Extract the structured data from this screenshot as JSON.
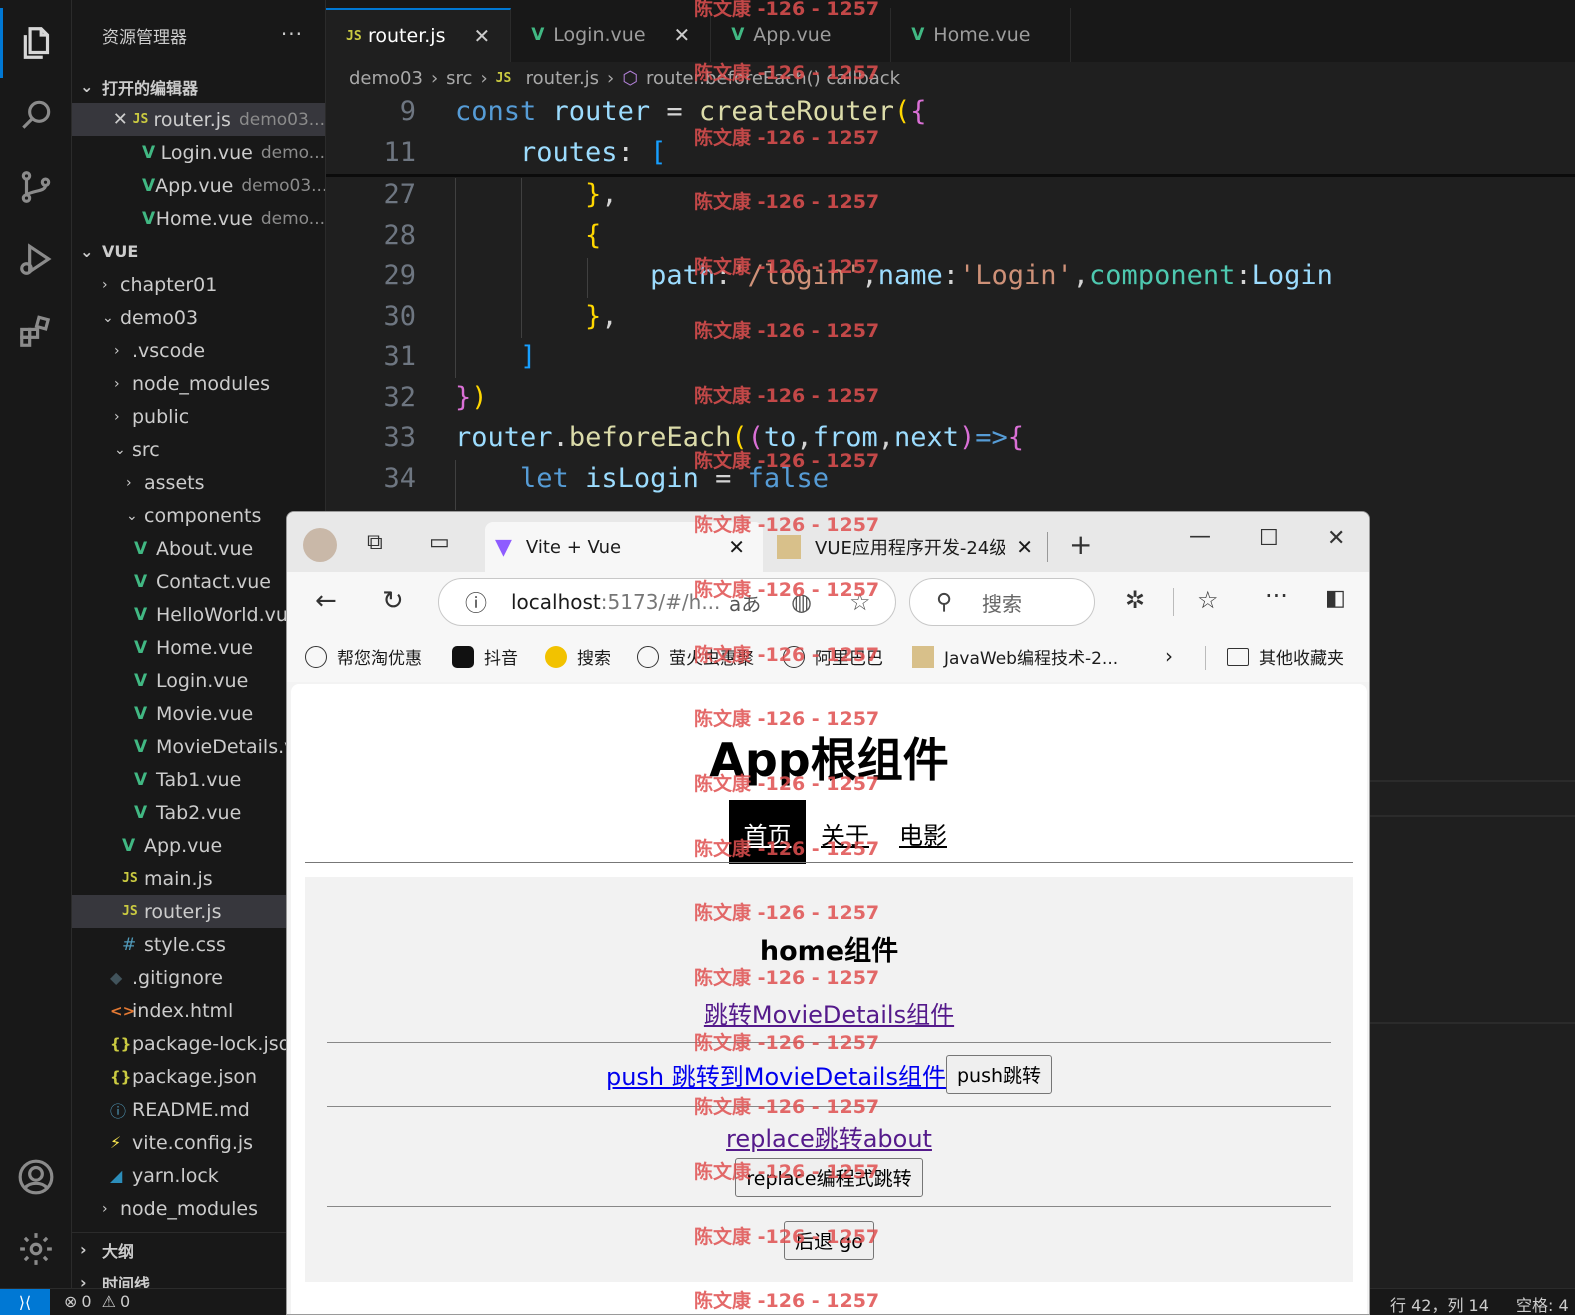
{
  "sidebar": {
    "title": "资源管理器",
    "more": "···",
    "open_editors": {
      "label": "打开的编辑器",
      "items": [
        {
          "name": "router.js",
          "desc": "demo03..."
        },
        {
          "name": "Login.vue",
          "desc": "demo..."
        },
        {
          "name": "App.vue",
          "desc": "demo03..."
        },
        {
          "name": "Home.vue",
          "desc": "demo..."
        }
      ]
    },
    "workspace": "VUE",
    "tree": {
      "chapter01": "chapter01",
      "demo03": "demo03",
      "vscode": ".vscode",
      "node_modules": "node_modules",
      "public": "public",
      "src": "src",
      "assets": "assets",
      "components": "components",
      "components_files": [
        "About.vue",
        "Contact.vue",
        "HelloWorld.vue",
        "Home.vue",
        "Login.vue",
        "Movie.vue",
        "MovieDetails.vue",
        "Tab1.vue",
        "Tab2.vue"
      ],
      "app": "App.vue",
      "main": "main.js",
      "router": "router.js",
      "style": "style.css",
      "gitignore": ".gitignore",
      "index": "index.html",
      "lock": "package-lock.json",
      "pkg": "package.json",
      "readme": "README.md",
      "vite": "vite.config.js",
      "yarn": "yarn.lock",
      "node_modules2": "node_modules"
    },
    "outline": "大纲",
    "timeline": "时间线"
  },
  "editor": {
    "tabs": [
      "router.js",
      "Login.vue",
      "App.vue",
      "Home.vue"
    ],
    "breadcrumb": [
      "demo03",
      "src",
      "router.js",
      "router.beforeEach() callback"
    ],
    "lines": [
      "9",
      "11",
      "27",
      "28",
      "29",
      "30",
      "31",
      "32",
      "33",
      "34"
    ],
    "code": {
      "l9": [
        "const",
        "router",
        "=",
        "createRouter",
        "(",
        "{"
      ],
      "l11": [
        "routes",
        ":",
        "["
      ],
      "l27": [
        "}",
        ","
      ],
      "l28": [
        "{"
      ],
      "l29": [
        "path",
        ":",
        "'/login'",
        ",",
        "name",
        ":",
        "'Login'",
        ",",
        "component",
        ":",
        "Login"
      ],
      "l30": [
        "}",
        ","
      ],
      "l31": [
        "]"
      ],
      "l32": [
        "}",
        ")"
      ],
      "l33": [
        "router",
        ".",
        "beforeEach",
        "(",
        "(",
        "to",
        ",",
        "from",
        ",",
        "next",
        ")",
        "=>",
        "{"
      ],
      "l34": [
        "let",
        "isLogin",
        "=",
        "false"
      ]
    }
  },
  "status": {
    "errors": "0",
    "warnings": "0",
    "position": "行 42，列 14",
    "spaces": "空格: 4"
  },
  "browser": {
    "tabs": [
      {
        "title": "Vite + Vue"
      },
      {
        "title": "VUE应用程序开发-24级"
      }
    ],
    "url_host": "localhost",
    "url_rest": ":5173/#/h...",
    "aa": "aあ",
    "search_placeholder": "搜索",
    "bookmarks": [
      "帮您淘优惠",
      "抖音",
      "搜索",
      "萤火虫惠聚",
      "阿里巴巴",
      "JavaWeb编程技术-2...",
      "其他收藏夹"
    ],
    "page": {
      "h1": "App根组件",
      "nav": [
        "首页",
        "关于",
        "电影"
      ],
      "home_title": "home组件",
      "link1": "跳转MovieDetails组件",
      "link2": "push 跳转到MovieDetails组件",
      "btn_push": "push跳转",
      "link3": "replace跳转about",
      "btn_replace": "replace编程式跳转",
      "btn_back": "后退 go"
    }
  },
  "watermark": "陈文康 -126 - 1257"
}
